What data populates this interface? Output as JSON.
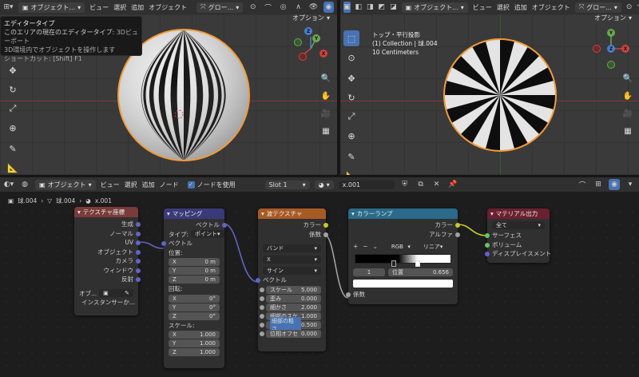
{
  "left_header": {
    "mode": "オブジェクト...",
    "menu": [
      "ビュー",
      "選択",
      "追加",
      "オブジェクト"
    ],
    "transform": "グロー...",
    "options": "オプション"
  },
  "tooltip": {
    "title": "エディタータイプ",
    "desc_prefix": "このエリアの現在のエディタータイプ:",
    "desc_value": "3Dビューポート",
    "desc2": "3D環境内でオブジェクトを操作します",
    "shortcut": "ショートカット: [Shift] F1"
  },
  "right_header": {
    "mode": "オブジェクト...",
    "menu": [
      "ビュー",
      "選択",
      "追加",
      "オブジェクト"
    ],
    "transform": "グロー...",
    "options": "オプション"
  },
  "right_viewport_info": {
    "line1": "トップ・平行投影",
    "line2": "(1) Collection | 球.004",
    "line3": "10 Centimeters"
  },
  "node_header": {
    "mode": "オブジェクト",
    "menu": [
      "ビュー",
      "選択",
      "追加",
      "ノード"
    ],
    "use_nodes": "ノードを使用",
    "slot": "Slot 1",
    "material": "x.001"
  },
  "breadcrumb": {
    "object": "球.004",
    "mesh": "球.004",
    "material": "x.001"
  },
  "nodes": {
    "texcoord": {
      "title": "テクスチャ座標",
      "outputs": [
        "生成",
        "ノーマル",
        "UV",
        "オブジェクト",
        "カメラ",
        "ウィンドウ",
        "反射"
      ],
      "object_label": "オブ...",
      "instancer": "インスタンサーか..."
    },
    "mapping": {
      "title": "マッピング",
      "output": "ベクトル",
      "type_label": "タイプ:",
      "type_value": "ポイント",
      "input_vector": "ベクトル",
      "location_label": "位置:",
      "location": [
        {
          "axis": "X",
          "value": "0 m"
        },
        {
          "axis": "Y",
          "value": "0 m"
        },
        {
          "axis": "Z",
          "value": "0 m"
        }
      ],
      "rotation_label": "回転:",
      "rotation": [
        {
          "axis": "X",
          "value": "0°"
        },
        {
          "axis": "Y",
          "value": "0°"
        },
        {
          "axis": "Z",
          "value": "0°"
        }
      ],
      "scale_label": "スケール:",
      "scale": [
        {
          "axis": "X",
          "value": "1.000"
        },
        {
          "axis": "Y",
          "value": "1.000"
        },
        {
          "axis": "Z",
          "value": "1.000"
        }
      ]
    },
    "wave": {
      "title": "波テクスチャ",
      "out_color": "カラー",
      "out_fac": "係数",
      "wave_type": "バンド",
      "direction": "X",
      "profile": "サイン",
      "input_vector": "ベクトル",
      "params": [
        {
          "label": "スケール",
          "value": "5.000"
        },
        {
          "label": "歪み",
          "value": "0.000"
        },
        {
          "label": "細かさ",
          "value": "2.000"
        },
        {
          "label": "細部のスケ",
          "value": "1.000"
        },
        {
          "label": "細部の粗さ",
          "value": "0.500"
        },
        {
          "label": "位相オフセ",
          "value": "0.000"
        }
      ]
    },
    "colorramp": {
      "title": "カラーランプ",
      "out_color": "カラー",
      "out_alpha": "アルファ",
      "color_mode": "RGB",
      "interpolation": "リニア",
      "index": "1",
      "pos_label": "位置",
      "pos_value": "0.656",
      "in_fac": "係数"
    },
    "output": {
      "title": "マテリアル出力",
      "target": "全て",
      "inputs": [
        "サーフェス",
        "ボリューム",
        "ディスプレイスメント"
      ]
    }
  },
  "colors": {
    "accent": "#4772b3",
    "texture_header": "#7a3b3b",
    "vector_header": "#3a3a7a",
    "tex_header": "#a85a24",
    "converter_header": "#2a6a8a",
    "output_header": "#6a2030",
    "socket_vector": "#6363c7",
    "socket_color": "#c7c729",
    "socket_float": "#a1a1a1",
    "socket_shader": "#63c763",
    "selection": "#f29b38"
  }
}
